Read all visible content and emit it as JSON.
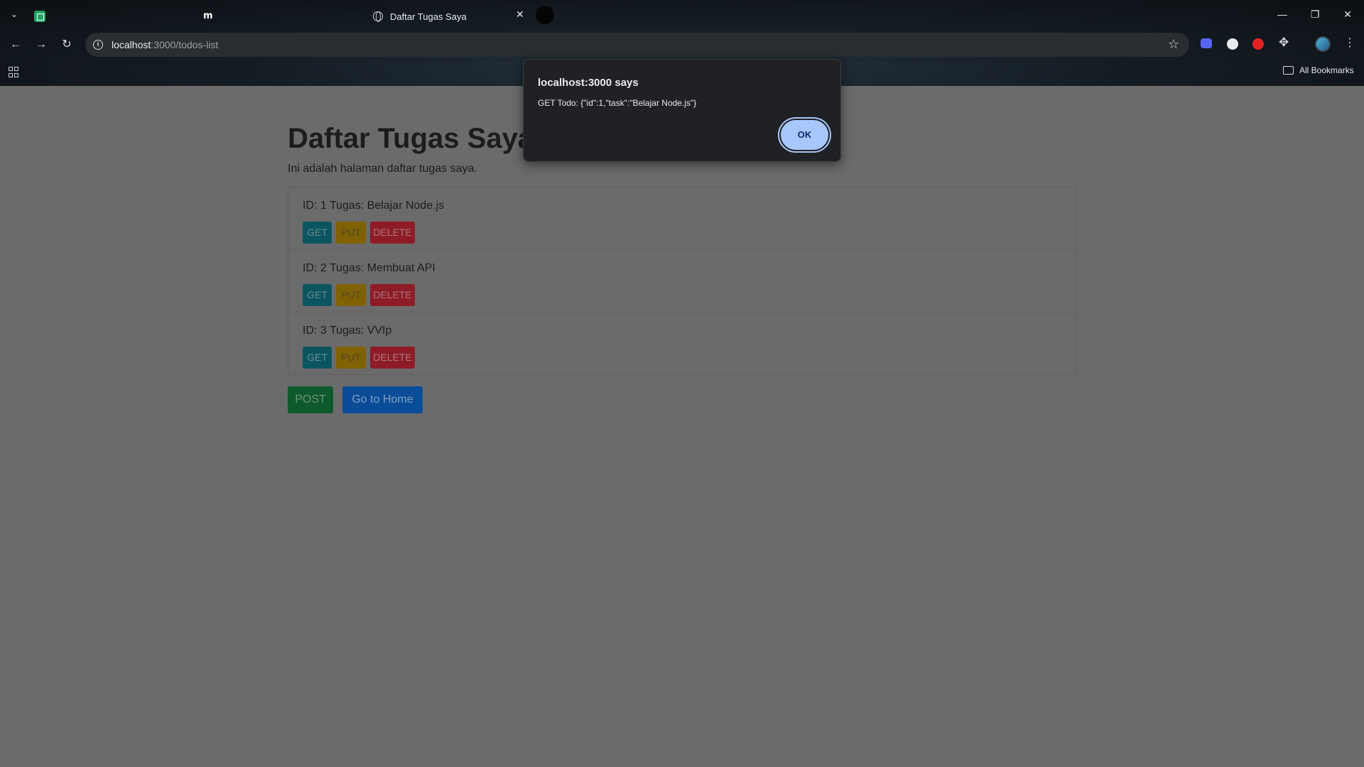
{
  "browser": {
    "tabs": [
      {
        "title": "",
        "icon": "sheets-icon"
      },
      {
        "title": "",
        "icon": "m-logo-icon"
      },
      {
        "title": "Daftar Tugas Saya",
        "icon": "globe-icon",
        "active": true
      }
    ],
    "close_glyph": "✕",
    "url_host": "localhost",
    "url_path": ":3000/todos-list",
    "bookmarks_label": "All Bookmarks"
  },
  "page": {
    "title": "Daftar Tugas Saya",
    "subtitle": "Ini adalah halaman daftar tugas saya.",
    "todos": [
      {
        "text": "ID: 1 Tugas: Belajar Node.js"
      },
      {
        "text": "ID: 2 Tugas: Membuat API"
      },
      {
        "text": "ID: 3 Tugas: VVIp"
      }
    ],
    "buttons": {
      "get": "GET",
      "put": "PUT",
      "delete": "DELETE"
    },
    "post_label": "POST",
    "home_label": "Go to Home"
  },
  "dialog": {
    "title": "localhost:3000 says",
    "message": "GET Todo: {\"id\":1,\"task\":\"Belajar Node.js\"}",
    "ok_label": "OK"
  },
  "colors": {
    "get": "#17a2b8",
    "put": "#ffc107",
    "delete": "#dc3545",
    "post": "#198754",
    "home": "#0d6efd",
    "dialog_accent": "#a8c7fa"
  }
}
